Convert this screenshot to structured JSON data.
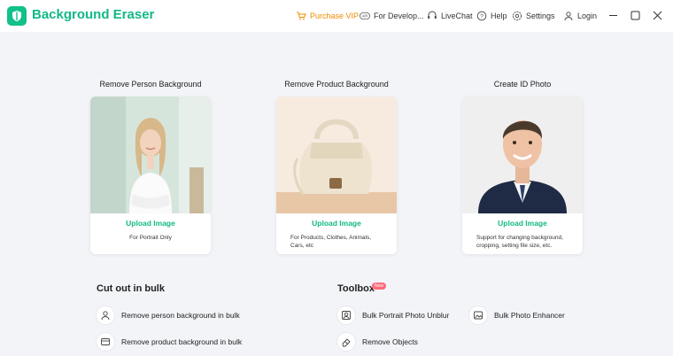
{
  "app": {
    "title": "Background Eraser"
  },
  "topnav": {
    "purchase": "Purchase VIP",
    "developers": "For Develop...",
    "livechat": "LiveChat",
    "help": "Help",
    "settings": "Settings",
    "login": "Login"
  },
  "colors": {
    "brand": "#12b886",
    "purchase": "#f08c00",
    "badge": "#ff6b7a"
  },
  "cards": [
    {
      "title": "Remove Person Background",
      "upload": "Upload Image",
      "note": "For Portrait Only"
    },
    {
      "title": "Remove Product Background",
      "upload": "Upload Image",
      "note": "For Products, Clothes, Animals, Cars, etc"
    },
    {
      "title": "Create ID Photo",
      "upload": "Upload Image",
      "note": "Support for changing background, cropping, setting file size, etc."
    }
  ],
  "bulk": {
    "title": "Cut out in bulk",
    "items": [
      "Remove person background in bulk",
      "Remove product background in bulk"
    ]
  },
  "toolbox": {
    "title": "Toolbox",
    "badge": "New",
    "items": [
      "Bulk Portrait Photo Unblur",
      "Bulk Photo Enhancer",
      "Remove Objects"
    ]
  }
}
